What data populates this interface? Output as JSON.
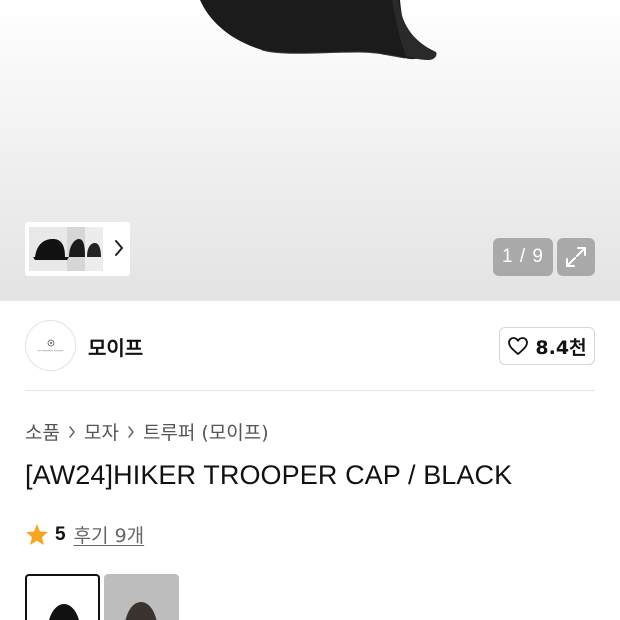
{
  "gallery": {
    "counter": "1 / 9",
    "thumbnail_icon": "chevron-right-icon",
    "expand_icon": "expand-icon"
  },
  "brand": {
    "name": "모이프",
    "likes": "8.4천",
    "like_icon": "heart-outline-icon"
  },
  "breadcrumb": {
    "items": [
      "소품",
      "모자",
      "트루퍼 (모이프)"
    ]
  },
  "product": {
    "title": "[AW24]HIKER TROOPER CAP / BLACK"
  },
  "rating": {
    "score": "5",
    "review_link": "후기 9개",
    "star_color": "#f5a623"
  },
  "options": {
    "selected_index": 0
  }
}
